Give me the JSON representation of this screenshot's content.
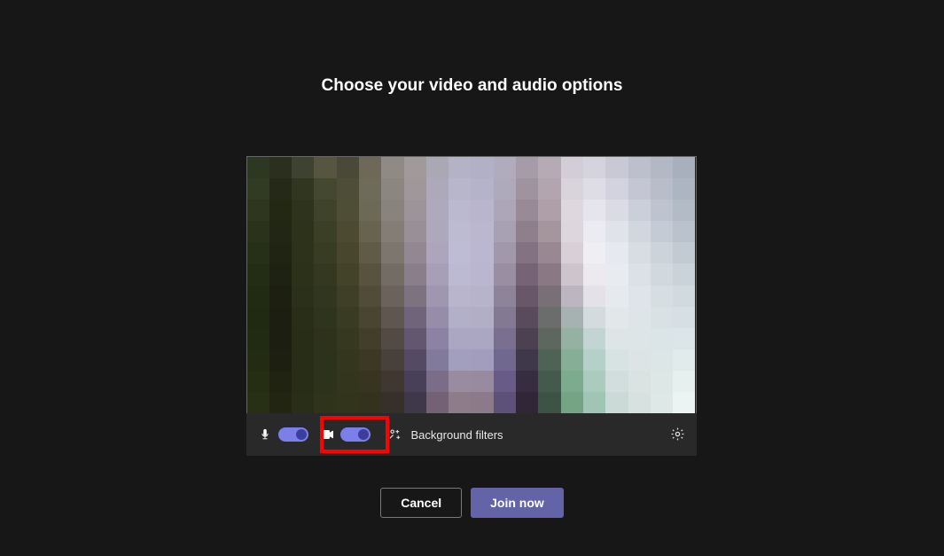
{
  "title": "Choose your video and audio options",
  "controls": {
    "mic_on": true,
    "camera_on": true,
    "background_filters_label": "Background filters"
  },
  "actions": {
    "cancel_label": "Cancel",
    "join_label": "Join now"
  },
  "colors": {
    "accent": "#6264a7",
    "toggle_track": "#7a80e8",
    "toggle_knob": "#3a3f9e",
    "highlight": "#ff0000"
  },
  "icons": {
    "mic": "microphone-icon",
    "camera": "camera-icon",
    "sparkle": "sparkle-icon",
    "gear": "gear-icon"
  },
  "pixel_colors": [
    [
      "#2d3822",
      "#2b2f1e",
      "#3d4330",
      "#565540",
      "#4a4836",
      "#6d6858",
      "#8f8b84",
      "#a19a9a",
      "#aba8b6",
      "#b4b3c6",
      "#b2b0c4",
      "#b0acbd",
      "#a69ca9",
      "#b6abb5",
      "#d2cdd6",
      "#d5d4de",
      "#c9c9d5",
      "#bdbfcc",
      "#b3b8c5",
      "#a8b0be"
    ],
    [
      "#313a23",
      "#242a17",
      "#30361f",
      "#44482e",
      "#4e4e38",
      "#6f6b5a",
      "#8c8680",
      "#a0979a",
      "#ada9ba",
      "#b7b6cb",
      "#b5b3c9",
      "#aea9bb",
      "#a093a0",
      "#b3a5af",
      "#d9d3db",
      "#dedce5",
      "#d2d3de",
      "#c4c7d3",
      "#b8bdc9",
      "#adb5c2"
    ],
    [
      "#2e3620",
      "#232815",
      "#2d331c",
      "#3f4329",
      "#4e4d35",
      "#6d6957",
      "#88837c",
      "#9d9499",
      "#aea9bc",
      "#bab9cf",
      "#b8b5cc",
      "#aca6b8",
      "#998a97",
      "#ae9fa8",
      "#ded7de",
      "#e6e4ec",
      "#dadbe5",
      "#cbcfd9",
      "#bec4cf",
      "#b3bbc7"
    ],
    [
      "#2a321c",
      "#222614",
      "#2d331a",
      "#3b3f26",
      "#4c4b32",
      "#686350",
      "#837d76",
      "#998f96",
      "#aea8bd",
      "#bdbbd2",
      "#bab7cf",
      "#a8a0b3",
      "#8f7f8c",
      "#a5959d",
      "#ded6dd",
      "#ecebf1",
      "#e1e3eb",
      "#d2d6df",
      "#c5cbd4",
      "#bac3cd"
    ],
    [
      "#262f18",
      "#202413",
      "#2d331a",
      "#373c23",
      "#48472e",
      "#605b49",
      "#7c766f",
      "#938891",
      "#aca5bc",
      "#bebcd4",
      "#bbb7d0",
      "#a298ab",
      "#837281",
      "#998892",
      "#d9d0d7",
      "#efeef3",
      "#e6e9ef",
      "#d8dde4",
      "#ccd3da",
      "#c2cbd3"
    ],
    [
      "#232c15",
      "#1e2212",
      "#2c321a",
      "#343820",
      "#43432a",
      "#585340",
      "#736c65",
      "#897e89",
      "#a79fb7",
      "#bcbad2",
      "#bab6cf",
      "#998ea2",
      "#766476",
      "#8a7985",
      "#cec4cc",
      "#eceaef",
      "#e8ebf0",
      "#dce1e7",
      "#d1d9de",
      "#c9d3d9"
    ],
    [
      "#212a13",
      "#1d2011",
      "#2a3019",
      "#31361e",
      "#3e3f26",
      "#504c39",
      "#6a625b",
      "#7d7280",
      "#9f97b0",
      "#b8b5cd",
      "#b7b3cb",
      "#8e849a",
      "#685669",
      "#797077",
      "#bbb6bf",
      "#e4e2e8",
      "#e6e9ee",
      "#dee4e9",
      "#d6dee2",
      "#d0dadf"
    ],
    [
      "#202912",
      "#1b1e10",
      "#282e18",
      "#2f341c",
      "#393b23",
      "#494533",
      "#5f574f",
      "#70647a",
      "#968daa",
      "#b2afc8",
      "#b2aec6",
      "#837993",
      "#594b5c",
      "#6b6d6c",
      "#a6b2b1",
      "#d3dbde",
      "#e2e7ea",
      "#dee5e8",
      "#d9e1e4",
      "#d6e0e4"
    ],
    [
      "#212a12",
      "#1b1e10",
      "#272d17",
      "#2e321b",
      "#36381f",
      "#413e2c",
      "#534b43",
      "#62576f",
      "#8c83a4",
      "#aba7c3",
      "#aba6c1",
      "#7a6f8f",
      "#4b4151",
      "#5d6760",
      "#95b1a3",
      "#c3d5d2",
      "#dde5e7",
      "#dde5e7",
      "#dbe4e6",
      "#dce6e8"
    ],
    [
      "#232c12",
      "#1d2010",
      "#272d17",
      "#2d321a",
      "#34361d",
      "#3b3926",
      "#48403a",
      "#544a63",
      "#817a9a",
      "#a29ebd",
      "#a29dbc",
      "#716890",
      "#3f384a",
      "#4e6255",
      "#86ae97",
      "#b5d0c8",
      "#d7e2e2",
      "#dce4e5",
      "#dce6e6",
      "#e1ebec"
    ],
    [
      "#252e13",
      "#202311",
      "#282d17",
      "#2d321a",
      "#33351c",
      "#373521",
      "#3f3730",
      "#484057",
      "#7b6d87",
      "#998ca0",
      "#988ba0",
      "#685b87",
      "#362d41",
      "#445a4c",
      "#7cab8e",
      "#aacbbe",
      "#d1dedd",
      "#dae3e2",
      "#dde7e6",
      "#e6f0ef"
    ],
    [
      "#272f14",
      "#222511",
      "#292e18",
      "#2e331a",
      "#32351b",
      "#33321e",
      "#37302a",
      "#3f384b",
      "#746176",
      "#8f7c8a",
      "#8c7a8a",
      "#5e5179",
      "#302638",
      "#3d5345",
      "#74a484",
      "#a1c5b4",
      "#cbd9d7",
      "#d7e1df",
      "#dee8e6",
      "#ebf4f2"
    ]
  ]
}
